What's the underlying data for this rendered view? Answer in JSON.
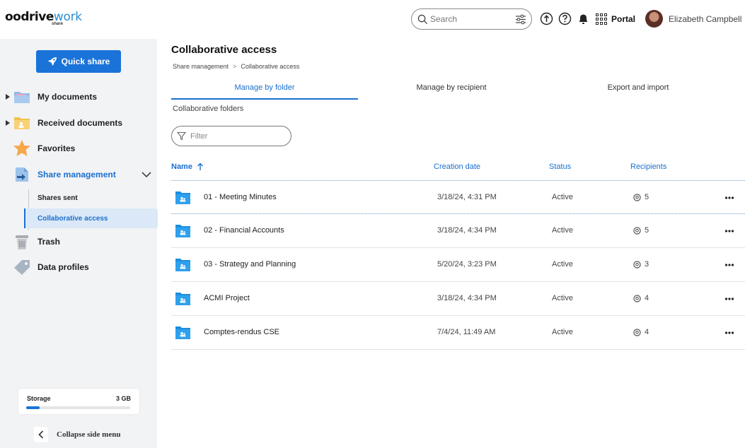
{
  "header": {
    "logo_main": "oodrive",
    "logo_accent": "work",
    "logo_sub": "share",
    "search_placeholder": "Search",
    "portal_label": "Portal",
    "user_name": "Elizabeth Campbell"
  },
  "sidebar": {
    "quick_share": "Quick share",
    "items": [
      {
        "label": "My documents",
        "icon": "my-documents-folder-icon"
      },
      {
        "label": "Received documents",
        "icon": "received-documents-folder-icon"
      },
      {
        "label": "Favorites",
        "icon": "star-icon"
      },
      {
        "label": "Share management",
        "icon": "share-management-icon"
      },
      {
        "label": "Trash",
        "icon": "trash-icon"
      },
      {
        "label": "Data profiles",
        "icon": "tag-icon"
      }
    ],
    "sub_items": [
      "Shares sent",
      "Collaborative access"
    ],
    "storage": {
      "label": "Storage",
      "value": "3 GB",
      "used_fraction": 0.13
    },
    "collapse_label": "Collapse side menu"
  },
  "main": {
    "title": "Collaborative access",
    "breadcrumb": [
      "Share management",
      "Collaborative access"
    ],
    "tabs": [
      "Manage by folder",
      "Manage by recipient",
      "Export and import"
    ],
    "section_label": "Collaborative folders",
    "filter_placeholder": "Filter",
    "columns": {
      "name": "Name",
      "creation_date": "Creation date",
      "status": "Status",
      "recipients": "Recipients"
    },
    "rows": [
      {
        "name": "01 - Meeting Minutes",
        "date": "3/18/24, 4:31 PM",
        "status": "Active",
        "recipients": "5"
      },
      {
        "name": "02 - Financial Accounts",
        "date": "3/18/24, 4:34 PM",
        "status": "Active",
        "recipients": "5"
      },
      {
        "name": "03 - Strategy and Planning",
        "date": "5/20/24, 3:23 PM",
        "status": "Active",
        "recipients": "3"
      },
      {
        "name": "ACMI Project",
        "date": "3/18/24, 4:34 PM",
        "status": "Active",
        "recipients": "4"
      },
      {
        "name": "Comptes-rendus CSE",
        "date": "7/4/24, 11:49 AM",
        "status": "Active",
        "recipients": "4"
      }
    ]
  },
  "colors": {
    "accent": "#1a73d9",
    "sidebar_bg": "#f2f3f5",
    "active_bg": "#dbe8f7"
  }
}
